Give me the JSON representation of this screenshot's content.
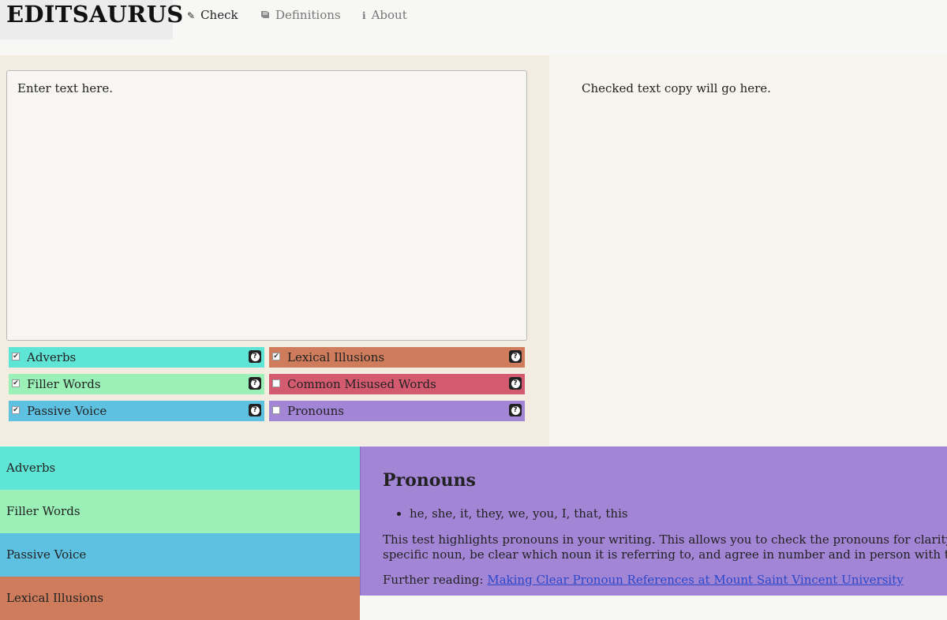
{
  "app": {
    "brand": "EDITSAURUS"
  },
  "nav": {
    "check": {
      "label": "Check",
      "icon": "pencil-icon"
    },
    "definitions": {
      "label": "Definitions",
      "icon": "book-icon"
    },
    "about": {
      "label": "About",
      "icon": "info-icon"
    }
  },
  "editor": {
    "placeholder": "Enter text here."
  },
  "output": {
    "text": "Checked text copy will go here."
  },
  "checks": [
    {
      "label": "Adverbs",
      "checked": true,
      "color": "#5fe5d6"
    },
    {
      "label": "Lexical Illusions",
      "checked": true,
      "color": "#cf7c5c"
    },
    {
      "label": "Filler Words",
      "checked": true,
      "color": "#9af0b6"
    },
    {
      "label": "Common Misused Words",
      "checked": false,
      "color": "#d45b6f"
    },
    {
      "label": "Passive Voice",
      "checked": true,
      "color": "#5ec1e1"
    },
    {
      "label": "Pronouns",
      "checked": false,
      "color": "#a385d6"
    }
  ],
  "categories": [
    {
      "label": "Adverbs",
      "color": "#5fe5d6"
    },
    {
      "label": "Filler Words",
      "color": "#9af0b6"
    },
    {
      "label": "Passive Voice",
      "color": "#5ec1e1"
    },
    {
      "label": "Lexical Illusions",
      "color": "#cf7c5c"
    }
  ],
  "definition": {
    "title": "Pronouns",
    "examples": "he, she, it, they, we, you, I, that, this",
    "description_line1": "This test highlights pronouns in your writing. This allows you to check the pronouns for clarity. A pronoun should always refer to a",
    "description_line2": "specific noun, be clear which noun it is referring to, and agree in number and in person with the noun it replaces.",
    "further_label": "Further reading:",
    "further_link": "Making Clear Pronoun References at Mount Saint Vincent University",
    "color": "#a385d6"
  }
}
